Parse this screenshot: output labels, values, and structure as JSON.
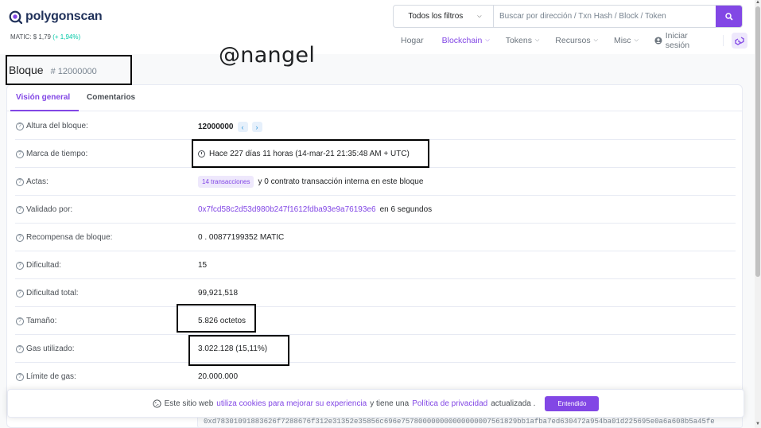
{
  "header": {
    "logo_text": "polygonscan",
    "price_label": "MATIC: $ 1,79",
    "price_change": "(+ 1,94%)",
    "search": {
      "filter_label": "Todos los filtros",
      "placeholder": "Buscar por dirección / Txn Hash / Block / Token"
    },
    "nav": [
      "Hogar",
      "Blockchain",
      "Tokens",
      "Recursos",
      "Misc"
    ],
    "signin": "Iniciar sesión"
  },
  "watermark": "@nangel",
  "page": {
    "title": "Bloque",
    "block_ref": "# 12000000"
  },
  "tabs": [
    "Visión general",
    "Comentarios"
  ],
  "rows": {
    "height": {
      "label": "Altura del bloque:",
      "value": "12000000"
    },
    "timestamp": {
      "label": "Marca de tiempo:",
      "value": "Hace 227 días 11 horas (14-mar-21 21:35:48 AM + UTC)"
    },
    "actas": {
      "label": "Actas:",
      "pill": "14 transacciones",
      "rest": "y 0 contrato transacción interna en este bloque"
    },
    "validated": {
      "label": "Validado por:",
      "address": "0x7fcd58c2d53d980b247f1612fdba93e9a76193e6",
      "suffix": "en 6 segundos"
    },
    "reward": {
      "label": "Recompensa de bloque:",
      "value": "0 . 00877199352 MATIC"
    },
    "difficulty": {
      "label": "Dificultad:",
      "value": "15"
    },
    "total_diff": {
      "label": "Dificultad total:",
      "value": "99,921,518"
    },
    "size": {
      "label": "Tamaño:",
      "value": "5.826 octetos"
    },
    "gas_used": {
      "label": "Gas utilizado:",
      "value": "3.022.128 (15,11%)"
    },
    "gas_limit": {
      "label": "Límite de gas:",
      "value": "20.000.000"
    }
  },
  "hash_partial": "0xd78301091883626f7288676f312e31352e35856c696e757800000000000000007561829bb1afba7ed630472a954ba01d225695e0a6a608b5a45fe",
  "cookie": {
    "text1": "Este sitio web",
    "link1": "utiliza cookies para mejorar su experiencia",
    "text2": "y tiene una",
    "link2": "Política de privacidad",
    "text3": "actualizada .",
    "button": "Entendido"
  },
  "colors": {
    "accent": "#8247e5",
    "positive": "#00c9a7"
  }
}
